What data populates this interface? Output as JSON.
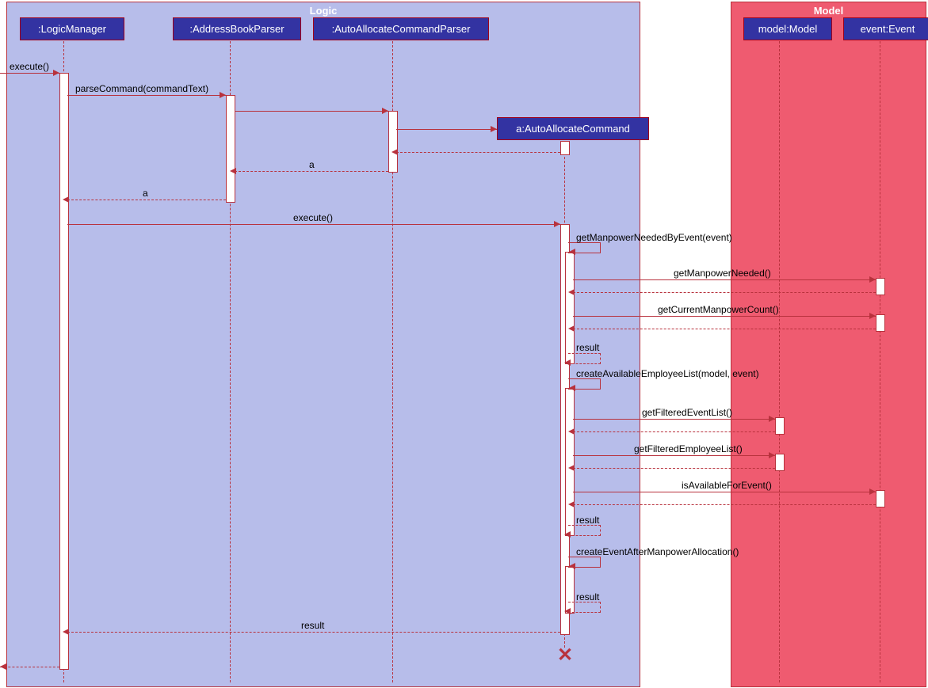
{
  "frames": {
    "logic_label": "Logic",
    "model_label": "Model"
  },
  "participants": {
    "logic_manager": ":LogicManager",
    "address_book_parser": ":AddressBookParser",
    "auto_allocate_parser": ":AutoAllocateCommandParser",
    "auto_allocate_command": "a:AutoAllocateCommand",
    "model": "model:Model",
    "event": "event:Event"
  },
  "messages": {
    "execute_in": "execute()",
    "parse_command": "parseCommand(commandText)",
    "return_a_1": "a",
    "return_a_2": "a",
    "execute_cmd": "execute()",
    "get_manpower_needed_by_event": "getManpowerNeededByEvent(event)",
    "get_manpower_needed": "getManpowerNeeded()",
    "get_current_manpower_count": "getCurrentManpowerCount()",
    "result_1": "result",
    "create_available_employee_list": "createAvailableEmployeeList(model, event)",
    "get_filtered_event_list": "getFilteredEventList()",
    "get_filtered_employee_list": "getFilteredEmployeeList()",
    "is_available_for_event": "isAvailableForEvent()",
    "result_2": "result",
    "create_event_after_manpower_allocation": "createEventAfterManpowerAllocation()",
    "result_3": "result",
    "result_final": "result"
  },
  "chart_data": {
    "type": "sequence_diagram",
    "frames": [
      {
        "name": "Logic",
        "participants": [
          ":LogicManager",
          ":AddressBookParser",
          ":AutoAllocateCommandParser",
          "a:AutoAllocateCommand"
        ]
      },
      {
        "name": "Model",
        "participants": [
          "model:Model",
          "event:Event"
        ]
      }
    ],
    "participants": [
      ":LogicManager",
      ":AddressBookParser",
      ":AutoAllocateCommandParser",
      "a:AutoAllocateCommand",
      "model:Model",
      "event:Event"
    ],
    "messages": [
      {
        "from": "external",
        "to": ":LogicManager",
        "label": "execute()",
        "type": "call"
      },
      {
        "from": ":LogicManager",
        "to": ":AddressBookParser",
        "label": "parseCommand(commandText)",
        "type": "call"
      },
      {
        "from": ":AddressBookParser",
        "to": ":AutoAllocateCommandParser",
        "label": "",
        "type": "call"
      },
      {
        "from": ":AutoAllocateCommandParser",
        "to": "a:AutoAllocateCommand",
        "label": "",
        "type": "create"
      },
      {
        "from": "a:AutoAllocateCommand",
        "to": ":AutoAllocateCommandParser",
        "label": "",
        "type": "return"
      },
      {
        "from": ":AutoAllocateCommandParser",
        "to": ":AddressBookParser",
        "label": "a",
        "type": "return"
      },
      {
        "from": ":AddressBookParser",
        "to": ":LogicManager",
        "label": "a",
        "type": "return"
      },
      {
        "from": ":LogicManager",
        "to": "a:AutoAllocateCommand",
        "label": "execute()",
        "type": "call"
      },
      {
        "from": "a:AutoAllocateCommand",
        "to": "a:AutoAllocateCommand",
        "label": "getManpowerNeededByEvent(event)",
        "type": "selfcall"
      },
      {
        "from": "a:AutoAllocateCommand",
        "to": "event:Event",
        "label": "getManpowerNeeded()",
        "type": "call"
      },
      {
        "from": "event:Event",
        "to": "a:AutoAllocateCommand",
        "label": "",
        "type": "return"
      },
      {
        "from": "a:AutoAllocateCommand",
        "to": "event:Event",
        "label": "getCurrentManpowerCount()",
        "type": "call"
      },
      {
        "from": "event:Event",
        "to": "a:AutoAllocateCommand",
        "label": "",
        "type": "return"
      },
      {
        "from": "a:AutoAllocateCommand",
        "to": "a:AutoAllocateCommand",
        "label": "result",
        "type": "selfreturn"
      },
      {
        "from": "a:AutoAllocateCommand",
        "to": "a:AutoAllocateCommand",
        "label": "createAvailableEmployeeList(model, event)",
        "type": "selfcall"
      },
      {
        "from": "a:AutoAllocateCommand",
        "to": "model:Model",
        "label": "getFilteredEventList()",
        "type": "call"
      },
      {
        "from": "model:Model",
        "to": "a:AutoAllocateCommand",
        "label": "",
        "type": "return"
      },
      {
        "from": "a:AutoAllocateCommand",
        "to": "model:Model",
        "label": "getFilteredEmployeeList()",
        "type": "call"
      },
      {
        "from": "model:Model",
        "to": "a:AutoAllocateCommand",
        "label": "",
        "type": "return"
      },
      {
        "from": "a:AutoAllocateCommand",
        "to": "event:Event",
        "label": "isAvailableForEvent()",
        "type": "call"
      },
      {
        "from": "event:Event",
        "to": "a:AutoAllocateCommand",
        "label": "",
        "type": "return"
      },
      {
        "from": "a:AutoAllocateCommand",
        "to": "a:AutoAllocateCommand",
        "label": "result",
        "type": "selfreturn"
      },
      {
        "from": "a:AutoAllocateCommand",
        "to": "a:AutoAllocateCommand",
        "label": "createEventAfterManpowerAllocation()",
        "type": "selfcall"
      },
      {
        "from": "a:AutoAllocateCommand",
        "to": "a:AutoAllocateCommand",
        "label": "result",
        "type": "selfreturn"
      },
      {
        "from": "a:AutoAllocateCommand",
        "to": ":LogicManager",
        "label": "result",
        "type": "return"
      },
      {
        "from": ":LogicManager",
        "to": "external",
        "label": "",
        "type": "return"
      },
      {
        "from": "a:AutoAllocateCommand",
        "to": "a:AutoAllocateCommand",
        "label": "",
        "type": "destroy"
      }
    ]
  }
}
